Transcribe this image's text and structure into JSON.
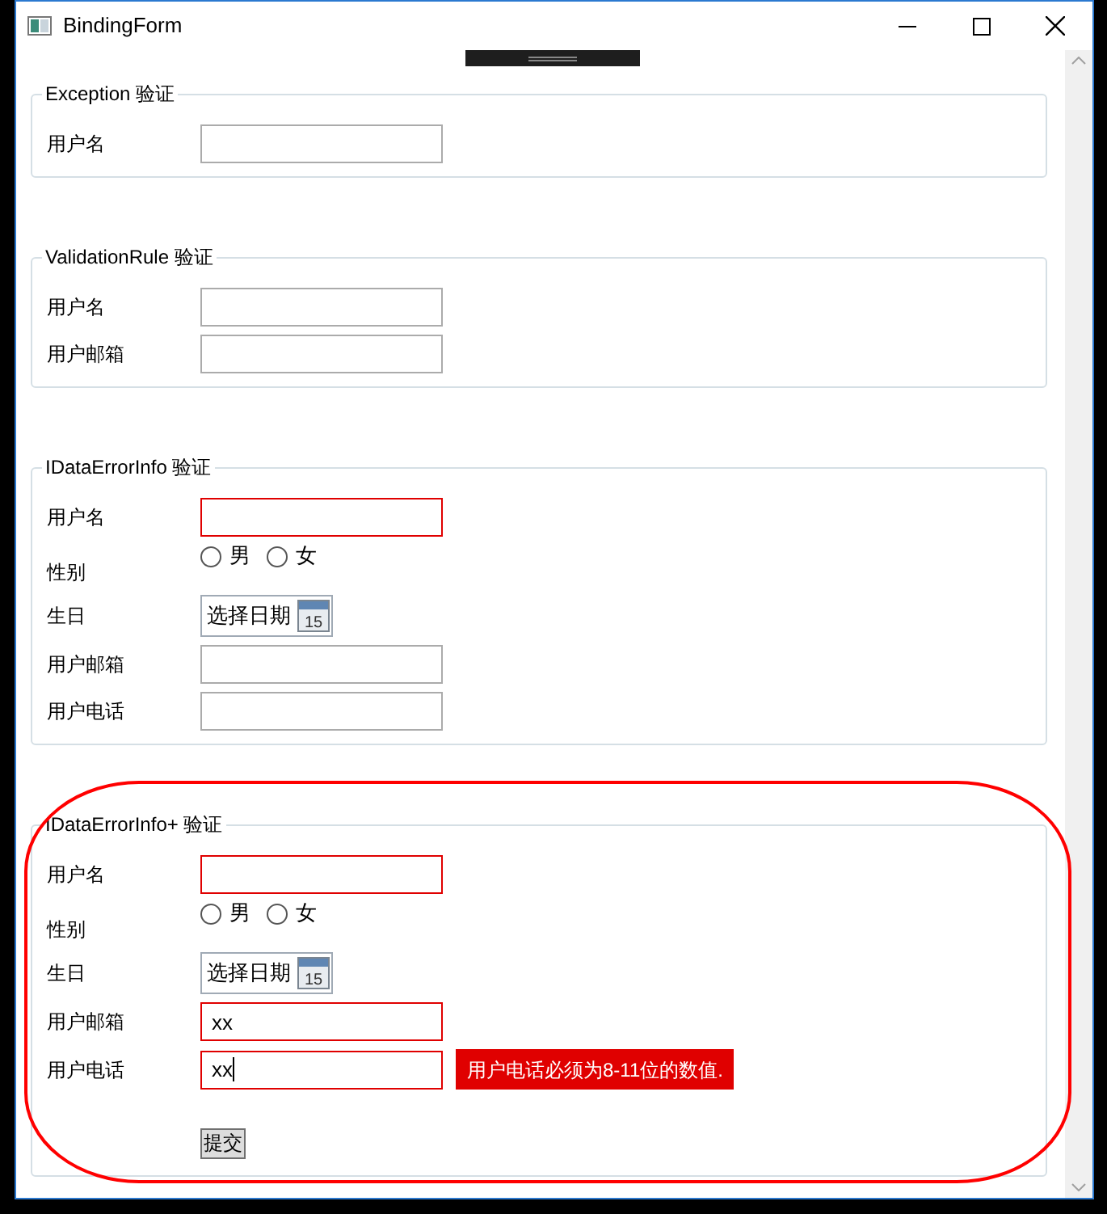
{
  "window": {
    "title": "BindingForm"
  },
  "sections": [
    {
      "title": "Exception 验证",
      "fields": [
        {
          "kind": "text",
          "label": "用户名",
          "error": false
        }
      ]
    },
    {
      "title": "ValidationRule 验证",
      "fields": [
        {
          "kind": "text",
          "label": "用户名",
          "error": false
        },
        {
          "kind": "text",
          "label": "用户邮箱",
          "error": false
        }
      ]
    },
    {
      "title": "IDataErrorInfo 验证",
      "fields": [
        {
          "kind": "text",
          "label": "用户名",
          "error": true
        },
        {
          "kind": "radio",
          "label": "性别",
          "options": [
            {
              "label": "男",
              "selected": false
            },
            {
              "label": "女",
              "selected": false
            }
          ]
        },
        {
          "kind": "date",
          "label": "生日",
          "placeholder": "选择日期",
          "icon_text": "15"
        },
        {
          "kind": "text",
          "label": "用户邮箱",
          "error": false
        },
        {
          "kind": "text",
          "label": "用户电话",
          "error": false
        }
      ]
    },
    {
      "title": "IDataErrorInfo+ 验证",
      "fields": [
        {
          "kind": "text",
          "label": "用户名",
          "error": true
        },
        {
          "kind": "radio",
          "label": "性别",
          "options": [
            {
              "label": "男",
              "selected": false
            },
            {
              "label": "女",
              "selected": false
            }
          ]
        },
        {
          "kind": "date",
          "label": "生日",
          "placeholder": "选择日期",
          "icon_text": "15"
        },
        {
          "kind": "text",
          "label": "用户邮箱",
          "value": "xx",
          "error": true
        },
        {
          "kind": "text",
          "label": "用户电话",
          "value": "xx",
          "error": true,
          "focused": true,
          "message": "用户电话必须为8-11位的数值."
        }
      ],
      "submit": {
        "label": "提交"
      }
    }
  ]
}
